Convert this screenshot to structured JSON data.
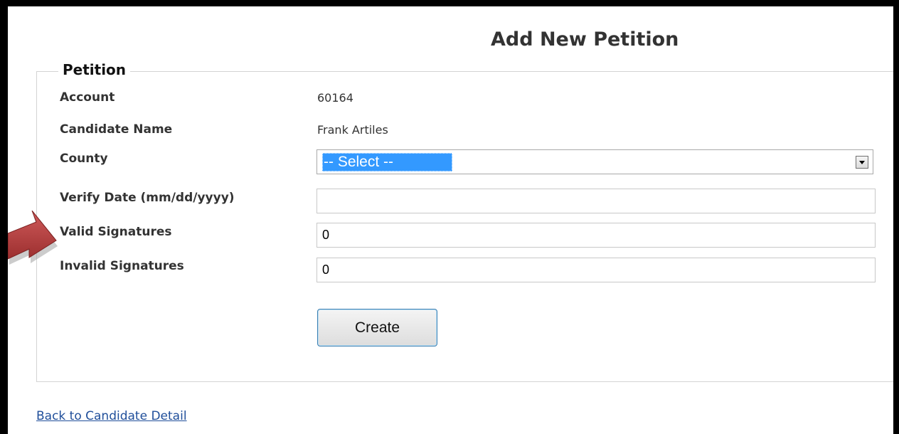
{
  "page": {
    "title": "Add New Petition"
  },
  "form": {
    "legend": "Petition",
    "fields": [
      {
        "label": "Account",
        "value": "60164"
      },
      {
        "label": "Candidate Name",
        "value": "Frank Artiles"
      },
      {
        "label": "County",
        "value": "-- Select --"
      },
      {
        "label": "Verify Date (mm/dd/yyyy)",
        "value": ""
      },
      {
        "label": "Valid Signatures",
        "value": "0"
      },
      {
        "label": "Invalid Signatures",
        "value": "0"
      }
    ],
    "submit_label": "Create"
  },
  "links": {
    "back": "Back to Candidate Detail"
  },
  "annotation": {
    "arrow_color": "#b33a3a",
    "icon": "right-arrow-icon"
  }
}
